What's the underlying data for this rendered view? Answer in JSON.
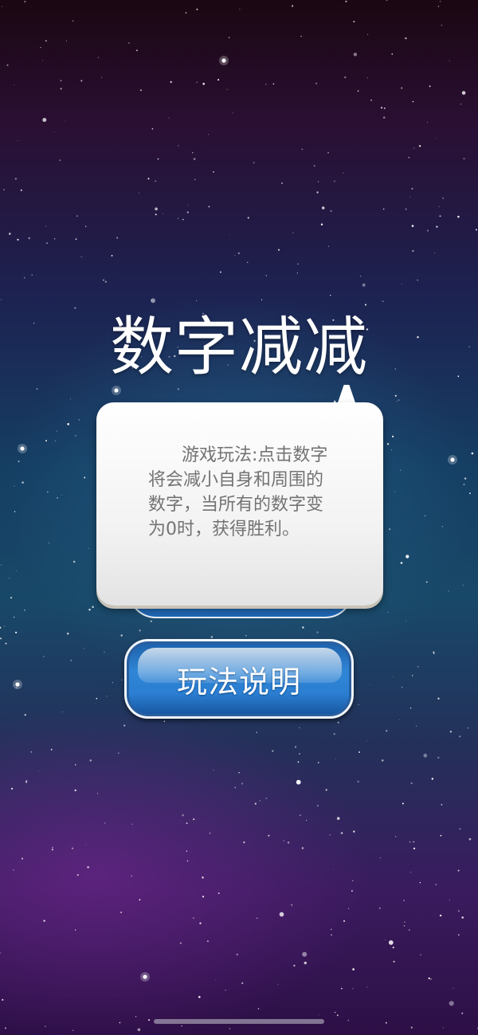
{
  "title": "数字减减",
  "dialog": {
    "text": "游戏玩法:点击数字将会减小自身和周围的数字，当所有的数字变为0时，获得胜利。"
  },
  "buttons": {
    "rules_label": "玩法说明"
  },
  "colors": {
    "button_blue": "#2f86d6",
    "dialog_text": "#737373",
    "title": "#ffffff"
  }
}
